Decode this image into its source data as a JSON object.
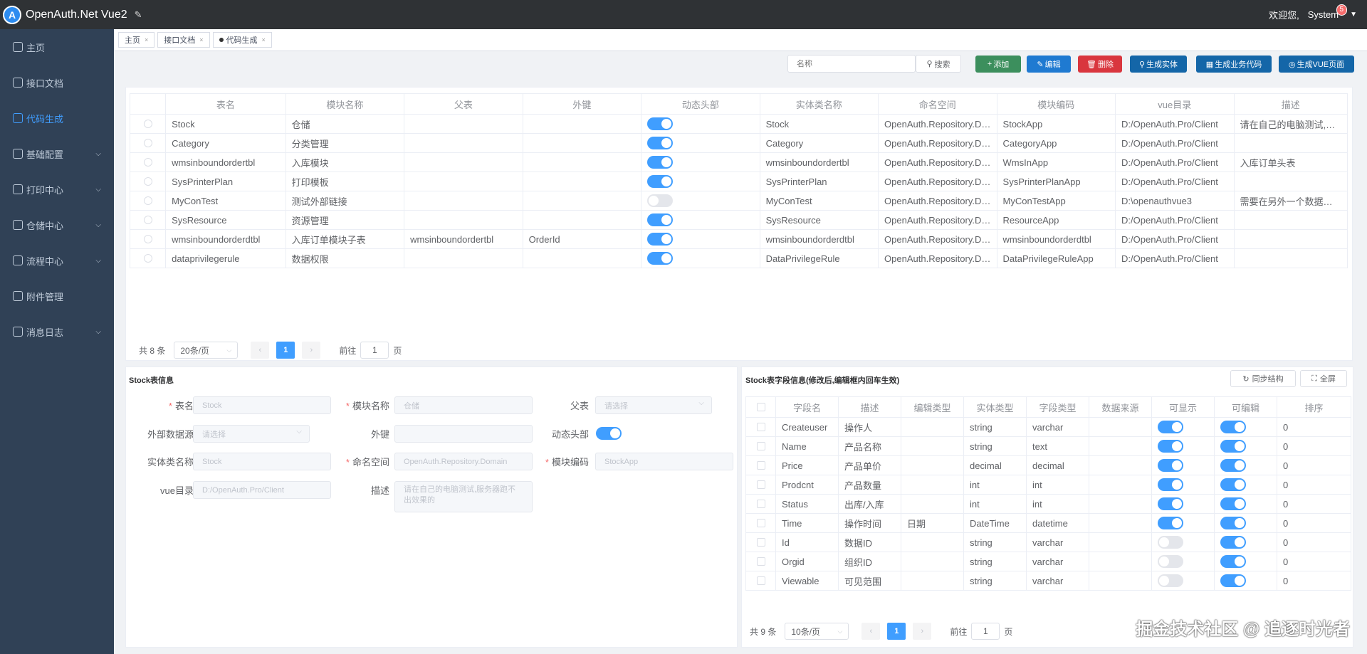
{
  "header": {
    "logo_letter": "A",
    "app_title": "OpenAuth.Net Vue2",
    "welcome": "欢迎您,",
    "user": "System",
    "badge": "5"
  },
  "sidebar": {
    "items": [
      {
        "label": "主页",
        "icon": "home-icon"
      },
      {
        "label": "接口文档",
        "icon": "api-icon"
      },
      {
        "label": "代码生成",
        "icon": "code-icon",
        "active": true
      },
      {
        "label": "基础配置",
        "icon": "gear-icon",
        "expand": true
      },
      {
        "label": "打印中心",
        "icon": "print-icon",
        "expand": true
      },
      {
        "label": "仓储中心",
        "icon": "warehouse-icon",
        "expand": true
      },
      {
        "label": "流程中心",
        "icon": "flow-icon",
        "expand": true
      },
      {
        "label": "附件管理",
        "icon": "attachment-icon"
      },
      {
        "label": "消息日志",
        "icon": "search-icon",
        "expand": true
      }
    ]
  },
  "tags": {
    "items": [
      {
        "label": "主页"
      },
      {
        "label": "接口文档"
      },
      {
        "label": "代码生成",
        "active": true
      }
    ]
  },
  "toolbar": {
    "search_placeholder": "名称",
    "search_label": "搜索",
    "add_label": "添加",
    "edit_label": "编辑",
    "delete_label": "删除",
    "gen_entity_label": "生成实体",
    "gen_biz_label": "生成业务代码",
    "gen_vue_label": "生成VUE页面"
  },
  "main_table": {
    "headers": [
      "表名",
      "模块名称",
      "父表",
      "外键",
      "动态头部",
      "实体类名称",
      "命名空间",
      "模块编码",
      "vue目录",
      "描述"
    ],
    "rows": [
      {
        "table": "Stock",
        "module": "仓储",
        "parent": "",
        "fk": "",
        "dyn": true,
        "entity": "Stock",
        "ns": "OpenAuth.Repository.Domain",
        "code": "StockApp",
        "vue": "D:/OpenAuth.Pro/Client",
        "desc": "请在自己的电脑测试,服务器跑不出效果的"
      },
      {
        "table": "Category",
        "module": "分类管理",
        "parent": "",
        "fk": "",
        "dyn": true,
        "entity": "Category",
        "ns": "OpenAuth.Repository.Domain",
        "code": "CategoryApp",
        "vue": "D:/OpenAuth.Pro/Client",
        "desc": ""
      },
      {
        "table": "wmsinboundordertbl",
        "module": "入库模块",
        "parent": "",
        "fk": "",
        "dyn": true,
        "entity": "wmsinboundordertbl",
        "ns": "OpenAuth.Repository.Domain",
        "code": "WmsInApp",
        "vue": "D:/OpenAuth.Pro/Client",
        "desc": "入库订单头表"
      },
      {
        "table": "SysPrinterPlan",
        "module": "打印模板",
        "parent": "",
        "fk": "",
        "dyn": true,
        "entity": "SysPrinterPlan",
        "ns": "OpenAuth.Repository.Domain",
        "code": "SysPrinterPlanApp",
        "vue": "D:/OpenAuth.Pro/Client",
        "desc": ""
      },
      {
        "table": "MyConTest",
        "module": "测试外部链接",
        "parent": "",
        "fk": "",
        "dyn": false,
        "entity": "MyConTest",
        "ns": "OpenAuth.Repository.Domain",
        "code": "MyConTestApp",
        "vue": "D:\\openauthvue3",
        "desc": "需要在另外一个数据库中测试"
      },
      {
        "table": "SysResource",
        "module": "资源管理",
        "parent": "",
        "fk": "",
        "dyn": true,
        "entity": "SysResource",
        "ns": "OpenAuth.Repository.Domain",
        "code": "ResourceApp",
        "vue": "D:/OpenAuth.Pro/Client",
        "desc": ""
      },
      {
        "table": "wmsinboundorderdtbl",
        "module": "入库订单模块子表",
        "parent": "wmsinboundordertbl",
        "fk": "OrderId",
        "dyn": true,
        "entity": "wmsinboundorderdtbl",
        "ns": "OpenAuth.Repository.Domain",
        "code": "wmsinboundorderdtbl",
        "vue": "D:/OpenAuth.Pro/Client",
        "desc": ""
      },
      {
        "table": "dataprivilegerule",
        "module": "数据权限",
        "parent": "",
        "fk": "",
        "dyn": true,
        "entity": "DataPrivilegeRule",
        "ns": "OpenAuth.Repository.Domain",
        "code": "DataPrivilegeRuleApp",
        "vue": "D:/OpenAuth.Pro/Client",
        "desc": ""
      }
    ]
  },
  "main_pager": {
    "total": "共 8 条",
    "size": "20条/页",
    "prev": "‹",
    "page": "1",
    "next": "›",
    "goto": "前往",
    "goto_value": "1",
    "unit": "页"
  },
  "form": {
    "title": "Stock表信息",
    "table_label": "表名",
    "table_value": "Stock",
    "module_label": "模块名称",
    "module_value": "仓储",
    "parent_label": "父表",
    "parent_placeholder": "请选择",
    "ext_label": "外部数据源",
    "ext_placeholder": "请选择",
    "fk_label": "外键",
    "fk_value": "",
    "dyn_label": "动态头部",
    "dyn_on": true,
    "entity_label": "实体类名称",
    "entity_value": "Stock",
    "ns_label": "命名空间",
    "ns_value": "OpenAuth.Repository.Domain",
    "code_label": "模块编码",
    "code_value": "StockApp",
    "vue_label": "vue目录",
    "vue_value": "D:/OpenAuth.Pro/Client",
    "desc_label": "描述",
    "desc_value": "请在自己的电脑测试,服务器跑不出效果的"
  },
  "fields": {
    "title": "Stock表字段信息(修改后,编辑框内回车生效)",
    "sync_label": "同步结构",
    "fullscreen_label": "全屏",
    "headers": [
      "字段名",
      "描述",
      "编辑类型",
      "实体类型",
      "字段类型",
      "数据来源",
      "可显示",
      "可编辑",
      "排序"
    ],
    "rows": [
      {
        "name": "Createuser",
        "desc": "操作人",
        "edit": "",
        "etype": "string",
        "ftype": "varchar",
        "src": "",
        "show": true,
        "editable": true,
        "sort": "0"
      },
      {
        "name": "Name",
        "desc": "产品名称",
        "edit": "",
        "etype": "string",
        "ftype": "text",
        "src": "",
        "show": true,
        "editable": true,
        "sort": "0"
      },
      {
        "name": "Price",
        "desc": "产品单价",
        "edit": "",
        "etype": "decimal",
        "ftype": "decimal",
        "src": "",
        "show": true,
        "editable": true,
        "sort": "0"
      },
      {
        "name": "Prodcnt",
        "desc": "产品数量",
        "edit": "",
        "etype": "int",
        "ftype": "int",
        "src": "",
        "show": true,
        "editable": true,
        "sort": "0"
      },
      {
        "name": "Status",
        "desc": "出库/入库",
        "edit": "",
        "etype": "int",
        "ftype": "int",
        "src": "",
        "show": true,
        "editable": true,
        "sort": "0"
      },
      {
        "name": "Time",
        "desc": "操作时间",
        "edit": "日期",
        "etype": "DateTime",
        "ftype": "datetime",
        "src": "",
        "show": true,
        "editable": true,
        "sort": "0"
      },
      {
        "name": "Id",
        "desc": "数据ID",
        "edit": "",
        "etype": "string",
        "ftype": "varchar",
        "src": "",
        "show": false,
        "editable": true,
        "sort": "0"
      },
      {
        "name": "Orgid",
        "desc": "组织ID",
        "edit": "",
        "etype": "string",
        "ftype": "varchar",
        "src": "",
        "show": false,
        "editable": true,
        "sort": "0"
      },
      {
        "name": "Viewable",
        "desc": "可见范围",
        "edit": "",
        "etype": "string",
        "ftype": "varchar",
        "src": "",
        "show": false,
        "editable": true,
        "sort": "0"
      }
    ]
  },
  "fields_pager": {
    "total": "共 9 条",
    "size": "10条/页",
    "prev": "‹",
    "page": "1",
    "next": "›",
    "goto": "前往",
    "goto_value": "1",
    "unit": "页"
  },
  "watermark": "掘金技术社区 @ 追逐时光者"
}
